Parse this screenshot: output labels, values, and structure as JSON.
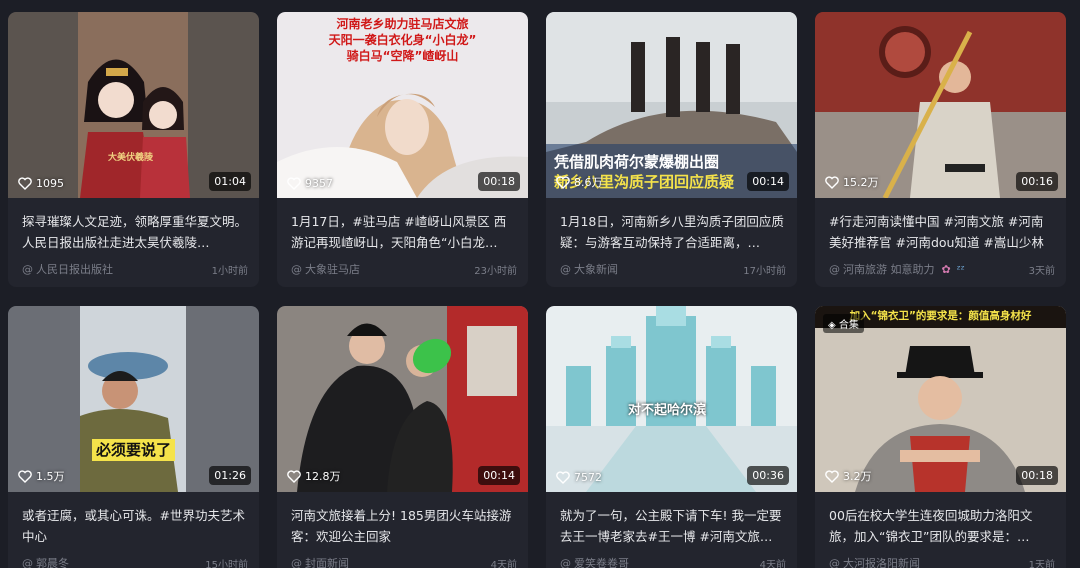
{
  "cards": [
    {
      "likes": "1095",
      "duration": "01:04",
      "title": "探寻璀璨人文足迹，领略厚重华夏文明。人民日报出版社走进太昊伏羲陵…",
      "author": "人民日报出版社",
      "time": "1小时前",
      "overlay": "大美伏羲陵"
    },
    {
      "likes": "9357",
      "duration": "00:18",
      "title": "1月17日，#驻马店 #嵖岈山风景区 西游记再现嵖岈山，天阳角色“小白龙…",
      "author": "大象驻马店",
      "time": "23小时前",
      "overlay_lines": [
        "河南老乡助力驻马店文旅",
        "天阳一袭白衣化身“小白龙”",
        "骑白马“空降”嵖岈山"
      ]
    },
    {
      "likes": "8.6万",
      "duration": "00:14",
      "title": "1月18日，河南新乡八里沟质子团回应质疑：与游客互动保持了合适距离，…",
      "author": "大象新闻",
      "time": "17小时前",
      "overlay_lines": [
        "凭借肌肉荷尔蒙爆棚出圈",
        "新乡八里沟质子团回应质疑"
      ]
    },
    {
      "likes": "15.2万",
      "duration": "00:16",
      "title": "#行走河南读懂中国 #河南文旅 #河南美好推荐官 #河南dou知道 #嵩山少林寺",
      "author": "河南旅游 如意助力",
      "time": "3天前"
    },
    {
      "likes": "1.5万",
      "duration": "01:26",
      "title": "或者迂腐，或其心可诛。#世界功夫艺术中心",
      "author": "郭晨冬",
      "time": "15小时前",
      "overlay": "必须要说了"
    },
    {
      "likes": "12.8万",
      "duration": "00:14",
      "title": "河南文旅接着上分! 185男团火车站接游客：欢迎公主回家",
      "author": "封面新闻",
      "time": "4天前"
    },
    {
      "likes": "7572",
      "duration": "00:36",
      "title": "就为了一句，公主殿下请下车! 我一定要去王一博老家去#王一博 #河南文旅…",
      "author": "爱笑卷卷哥",
      "time": "4天前",
      "overlay": "对不起哈尔滨"
    },
    {
      "likes": "3.2万",
      "duration": "00:18",
      "title": "00后在校大学生连夜回城助力洛阳文旅，加入“锦衣卫”团队的要求是：…",
      "author": "大河报洛阳新闻",
      "time": "1天前",
      "badge": "合集",
      "overlay": "加入“锦衣卫”的要求是：颜值高身材好"
    }
  ],
  "colors": {
    "background": "#1c1e26",
    "card": "#23252e",
    "meta": "#7b7e89"
  }
}
